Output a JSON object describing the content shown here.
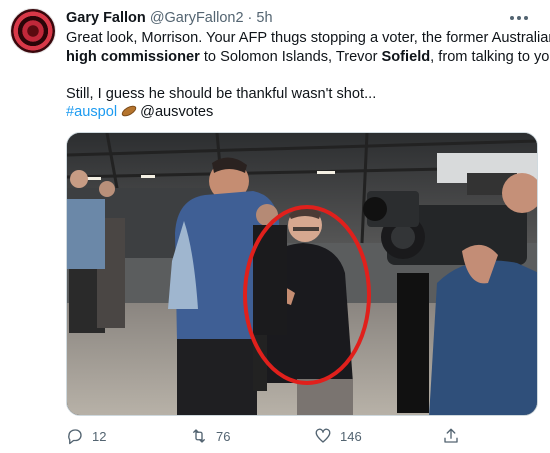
{
  "tweet": {
    "author_name": "Gary Fallon",
    "handle": "@GaryFallon2",
    "separator": "·",
    "time": "5h",
    "text": {
      "l1": "Great look, Morrison. Your AFP thugs stopping a voter, the former Australian",
      "l2_bold1": "high commissioner",
      "l2_mid": " to Solomon Islands, Trevor ",
      "l2_bold2": "Sofield",
      "l2_end": ", from talking to you!",
      "l3": "Still, I guess he should be thankful wasn't shot...",
      "hashtag": "#auspol",
      "mention": "@ausvotes"
    }
  },
  "actions": {
    "replies": "12",
    "retweets": "76",
    "likes": "146"
  },
  "icons": {
    "more": "more-horizontal-icon",
    "reply": "reply-icon",
    "retweet": "retweet-icon",
    "like": "heart-icon",
    "share": "share-icon",
    "hashtag_emoji": "football-emoji-icon"
  },
  "colors": {
    "link": "#1d9bf0",
    "meta": "#536471",
    "text": "#0f1419",
    "highlight_circle": "#e0201c"
  }
}
